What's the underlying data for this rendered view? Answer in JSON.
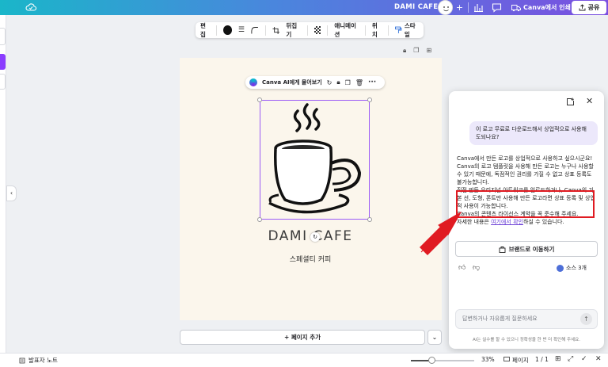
{
  "topbar": {
    "doc_title": "DAMI CAFE",
    "print_label": "Canva에서 인쇄",
    "share_label": "공유",
    "accent": "#8b3dff"
  },
  "edit_toolbar": {
    "edit_label": "편집",
    "flip_label": "뒤집기",
    "animate_label": "애니메이션",
    "position_label": "위치",
    "style_label": "스타일"
  },
  "canvas": {
    "ai_prompt_label": "Canva AI에게 물어보기",
    "brand_text": "DAMI CAFE",
    "subtitle": "스페셜티 커피",
    "background": "#fbf6ec"
  },
  "add_page_label": "+ 페이지 추가",
  "bottom": {
    "notes_label": "발표자 노트",
    "zoom": "33%",
    "zoom_fraction": 0.33,
    "pages_label": "페이지",
    "page_count": "1 / 1"
  },
  "assistant": {
    "user_question": "이 로고 무료로 다운로드해서 상업적으로 사용해도되나요?",
    "answer_1": "Canva에서 만든 로고를 상업적으로 사용하고 싶으시군요!",
    "answer_2": "Canva의 로고 템플릿을 사용해 만든 로고는 누구나 사용할 수 있기 때문에, 독점적인 권리를 가질 수 없고 상표 등록도 불가능합니다.",
    "answer_3": "직접 만든 오리지널 아트워크를 업로드하거나, Canva의 기본 선, 도형, 폰트만 사용해 만든 로고라면 상표 등록 및 상업적 사용이 가능합니다.",
    "answer_4": "Canva의 콘텐츠 라이선스 계약을 꼭 준수해 주세요.",
    "answer_5_prefix": "자세한 내용은 ",
    "answer_5_link": "여기에서 확인",
    "answer_5_suffix": "하실 수 있습니다.",
    "brand_button": "브랜드로 이동하기",
    "sources": "소스 3개",
    "input_placeholder": "답변하거나 자유롭게 질문하세요",
    "disclaimer": "AI는 실수를 할 수 있으니 정확성을 한 번 더 확인해 주세요.",
    "highlight_color": "#e01b22"
  }
}
